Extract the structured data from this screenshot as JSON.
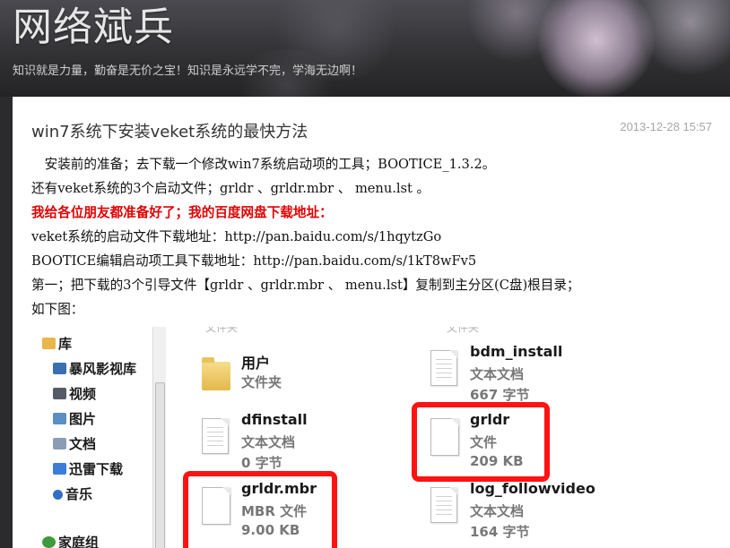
{
  "header": {
    "site_title": "网络斌兵",
    "site_subtitle": "知识就是力量，勤奋是无价之宝！知识是永远学不完，学海无边啊！"
  },
  "post": {
    "title": "win7系统下安装veket系统的最快方法",
    "date": "2013-12-28 15:57",
    "paragraphs": [
      "　安装前的准备；去下载一个修改win7系统启动项的工具；BOOTICE_1.3.2。",
      "还有veket系统的3个启动文件；grldr 、grldr.mbr 、 menu.lst 。",
      "我给各位朋友都准备好了；我的百度网盘下载地址：",
      "veket系统的启动文件下载地址：http://pan.baidu.com/s/1hqytzGo",
      "BOOTICE编辑启动项工具下载地址：http://pan.baidu.com/s/1kT8wFv5",
      "第一；把下载的3个引导文件【grldr 、grldr.mbr 、 menu.lst】复制到主分区(C盘)根目录；",
      "如下图："
    ]
  },
  "explorer": {
    "nav_items": [
      {
        "label": "库",
        "icon": "library-icon",
        "color": "#e8b64a"
      },
      {
        "label": "暴风影视库",
        "icon": "video-library-icon",
        "color": "#3a6fb0"
      },
      {
        "label": "视频",
        "icon": "video-icon",
        "color": "#555c66"
      },
      {
        "label": "图片",
        "icon": "picture-icon",
        "color": "#5b8ec2"
      },
      {
        "label": "文档",
        "icon": "document-icon",
        "color": "#8a9db5"
      },
      {
        "label": "迅雷下载",
        "icon": "xunlei-download-icon",
        "color": "#3b7dd8"
      },
      {
        "label": "音乐",
        "icon": "music-icon",
        "color": "#2f6fc4"
      },
      {
        "label": "家庭组",
        "icon": "homegroup-icon",
        "color": "#3d9b3d"
      }
    ],
    "partial_top_label": "文件夹",
    "files": [
      {
        "name": "用户",
        "type": "文件夹",
        "size": "",
        "icon": "folder-icon"
      },
      {
        "name": "bdm_install",
        "type": "文本文档",
        "size": "667 字节",
        "icon": "text-document-icon"
      },
      {
        "name": "dfinstall",
        "type": "文本文档",
        "size": "0 字节",
        "icon": "text-document-icon"
      },
      {
        "name": "grldr",
        "type": "文件",
        "size": "209 KB",
        "icon": "blank-file-icon"
      },
      {
        "name": "grldr.mbr",
        "type": "MBR 文件",
        "size": "9.00 KB",
        "icon": "blank-file-icon"
      },
      {
        "name": "log_followvideo",
        "type": "文本文档",
        "size": "164 字节",
        "icon": "text-document-icon"
      }
    ],
    "highlight_color": "#ff1212"
  }
}
